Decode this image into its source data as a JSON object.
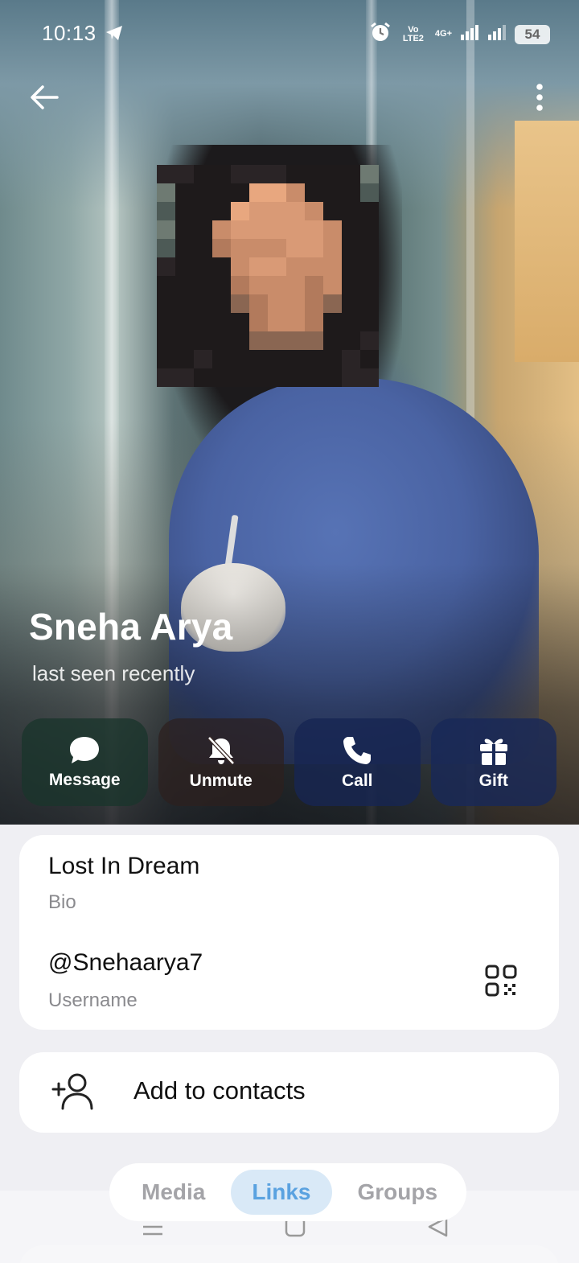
{
  "status_bar": {
    "time": "10:13",
    "volte": "Vo LTE2",
    "network": "4G+",
    "battery": "54"
  },
  "profile": {
    "name": "Sneha Arya",
    "status": "last seen recently"
  },
  "actions": [
    {
      "label": "Message",
      "icon": "message-bubble-icon"
    },
    {
      "label": "Unmute",
      "icon": "bell-off-icon"
    },
    {
      "label": "Call",
      "icon": "phone-icon"
    },
    {
      "label": "Gift",
      "icon": "gift-icon"
    }
  ],
  "info": {
    "bio": "Lost In Dream",
    "bio_label": "Bio",
    "username": "@Snehaarya7",
    "username_label": "Username"
  },
  "contacts": {
    "add_label": "Add to contacts"
  },
  "tabs": [
    {
      "label": "Media",
      "active": false
    },
    {
      "label": "Links",
      "active": true
    },
    {
      "label": "Groups",
      "active": false
    }
  ],
  "colors": {
    "accent": "#5aa2e0",
    "tab_active_bg": "#d9e9f7",
    "page_bg": "#efeff3"
  }
}
